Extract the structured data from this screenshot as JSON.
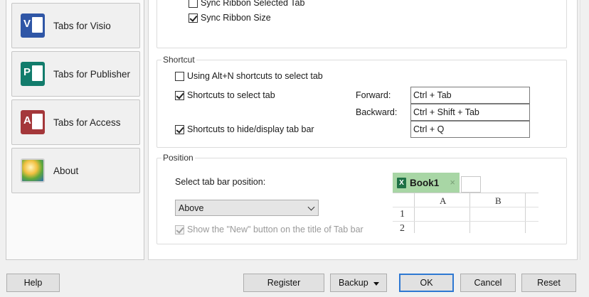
{
  "sidebar": {
    "items": [
      {
        "label": "Tabs for Visio",
        "icon": "visio-icon",
        "icon_letter": "V"
      },
      {
        "label": "Tabs for Publisher",
        "icon": "publisher-icon",
        "icon_letter": "P"
      },
      {
        "label": "Tabs for Access",
        "icon": "access-icon",
        "icon_letter": "A"
      },
      {
        "label": "About",
        "icon": "about-icon"
      }
    ]
  },
  "ribbon_group": {
    "sync_selected_tab": {
      "label": "Sync Ribbon Selected Tab",
      "checked": false
    },
    "sync_size": {
      "label": "Sync Ribbon Size",
      "checked": true
    }
  },
  "shortcut": {
    "title": "Shortcut",
    "alt_n": {
      "label": "Using Alt+N shortcuts to select tab",
      "checked": false
    },
    "select_tab": {
      "label": "Shortcuts to select tab",
      "checked": true
    },
    "hide_display": {
      "label": "Shortcuts to hide/display tab bar",
      "checked": true
    },
    "forward_label": "Forward:",
    "forward_value": "Ctrl + Tab",
    "backward_label": "Backward:",
    "backward_value": "Ctrl + Shift + Tab",
    "toggle_value": "Ctrl + Q"
  },
  "position": {
    "title": "Position",
    "select_label": "Select tab bar position:",
    "selected": "Above",
    "show_new": {
      "label": "Show the \"New\" button on the title of Tab bar",
      "checked": true,
      "disabled": true
    },
    "preview": {
      "tab_label": "Book1",
      "tab_close": "×",
      "excel_letter": "X",
      "col_a": "A",
      "col_b": "B",
      "row1": "1",
      "row2": "2"
    }
  },
  "buttons": {
    "help": "Help",
    "register": "Register",
    "backup": "Backup",
    "ok": "OK",
    "cancel": "Cancel",
    "reset": "Reset"
  },
  "colors": {
    "accent": "#2e78d2",
    "preview_tab": "#a8d6a5",
    "visio": "#2f56a6",
    "publisher": "#127c6c",
    "access": "#a4373a"
  }
}
